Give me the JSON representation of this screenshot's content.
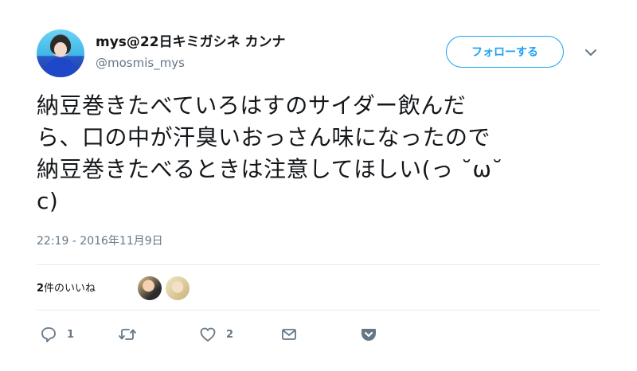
{
  "user": {
    "display_name": "mys@22日キミガシネ カンナ",
    "handle": "@mosmis_mys"
  },
  "follow_button": {
    "label": "フォローする"
  },
  "tweet": {
    "lines": [
      "納豆巻きたべていろはすのサイダー飲んだ",
      "ら、口の中が汗臭いおっさん味になったので",
      "納豆巻きたべるときは注意してほしい(っ ˘ω˘",
      "c)"
    ],
    "timestamp": "22:19 - 2016年11月9日"
  },
  "likes_summary": {
    "count": "2",
    "suffix": "件のいいね"
  },
  "actions": {
    "reply_count": "1",
    "retweet_count": "",
    "like_count": "2"
  },
  "colors": {
    "accent": "#1da1f2",
    "secondary_text": "#657786",
    "icon": "#657786"
  },
  "icons": [
    "reply-icon",
    "retweet-icon",
    "heart-icon",
    "mail-icon",
    "pocket-icon",
    "chevron-down-icon"
  ]
}
